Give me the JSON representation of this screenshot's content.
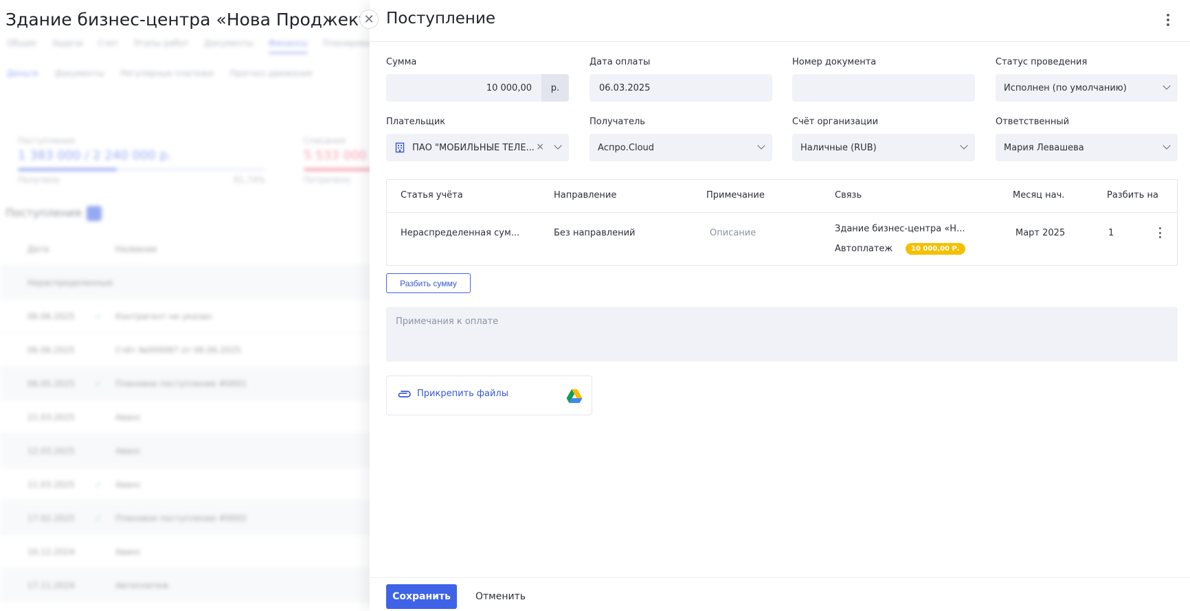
{
  "background": {
    "page_title": "Здание бизнес-центра «Нова Проджект»",
    "tabs": [
      "Общее",
      "Задачи",
      "Счет",
      "Этапы работ",
      "Документы",
      "Финансы",
      "Планирование"
    ],
    "subtabs": [
      "Деньги",
      "Документы",
      "Регулярные платежи",
      "Прогноз движения"
    ],
    "kpi_income": {
      "label": "Поступления",
      "value": "1 383 000 / 2 240 000 р.",
      "sub_left": "Получено",
      "sub_right": "61,74%"
    },
    "kpi_expense": {
      "label": "Списания",
      "value": "5 533 000",
      "sub_left": "Потрачено"
    },
    "section_title": "Поступления",
    "rows": [
      {
        "date": "Дата",
        "name": "Название"
      },
      {
        "date": "",
        "name": "Нераспределенные"
      },
      {
        "date": "06.06.2025",
        "name": "Контрагент не указан"
      },
      {
        "date": "06.06.2025",
        "name": "Счёт №000087 от 06.06.2025"
      },
      {
        "date": "06.05.2025",
        "name": "Плановое поступление #0001"
      },
      {
        "date": "21.03.2025",
        "name": "Аванс"
      },
      {
        "date": "12.03.2025",
        "name": "Аванс"
      },
      {
        "date": "11.03.2025",
        "name": "Аванс"
      },
      {
        "date": "17.02.2025",
        "name": "Плановое поступление #0002"
      },
      {
        "date": "16.12.2024",
        "name": "Аванс"
      },
      {
        "date": "17.11.2024",
        "name": "Автоплатеж"
      }
    ]
  },
  "panel": {
    "title": "Поступление",
    "menu_icon": "kebab-vertical-icon",
    "close_icon": "close-icon"
  },
  "fields": {
    "sum": {
      "label": "Сумма",
      "value": "10 000,00",
      "unit": "р."
    },
    "payment_date": {
      "label": "Дата оплаты",
      "value": "06.03.2025"
    },
    "doc_number": {
      "label": "Номер документа",
      "value": ""
    },
    "status": {
      "label": "Статус проведения",
      "value": "Исполнен (по умолчанию)"
    },
    "payer": {
      "label": "Плательщик",
      "value": "ПАО \"МОБИЛЬНЫЕ ТЕЛЕ...",
      "clear": "×",
      "icon": "building-icon"
    },
    "recipient": {
      "label": "Получатель",
      "value": "Аспро.Cloud"
    },
    "org_account": {
      "label": "Счёт организации",
      "value": "Наличные (RUB)"
    },
    "responsible": {
      "label": "Ответственный",
      "value": "Мария Левашева"
    }
  },
  "table": {
    "headers": [
      "Статья учёта",
      "Направление",
      "Примечание",
      "Связь",
      "Месяц нач.",
      "Разбить на"
    ],
    "row": {
      "article": "Нераспределенная сум...",
      "direction": "Без направлений",
      "note": "Описание",
      "link_line1": "Здание бизнес-центра «Н...",
      "link_line2": "Автоплатеж",
      "badge": "10 000,00 Р.",
      "month": "Март 2025",
      "split": "1"
    }
  },
  "split_button": "Разбить сумму",
  "notes": {
    "placeholder": "Примечания к оплате"
  },
  "attach": {
    "label": "Прикрепить файлы",
    "icon": "paperclip-icon",
    "drive_icon": "google-drive-icon"
  },
  "footer": {
    "save": "Сохранить",
    "cancel": "Отменить"
  },
  "colors": {
    "accent": "#3f63e6",
    "badge": "#f4c000",
    "field_bg": "#f0f2f7"
  }
}
